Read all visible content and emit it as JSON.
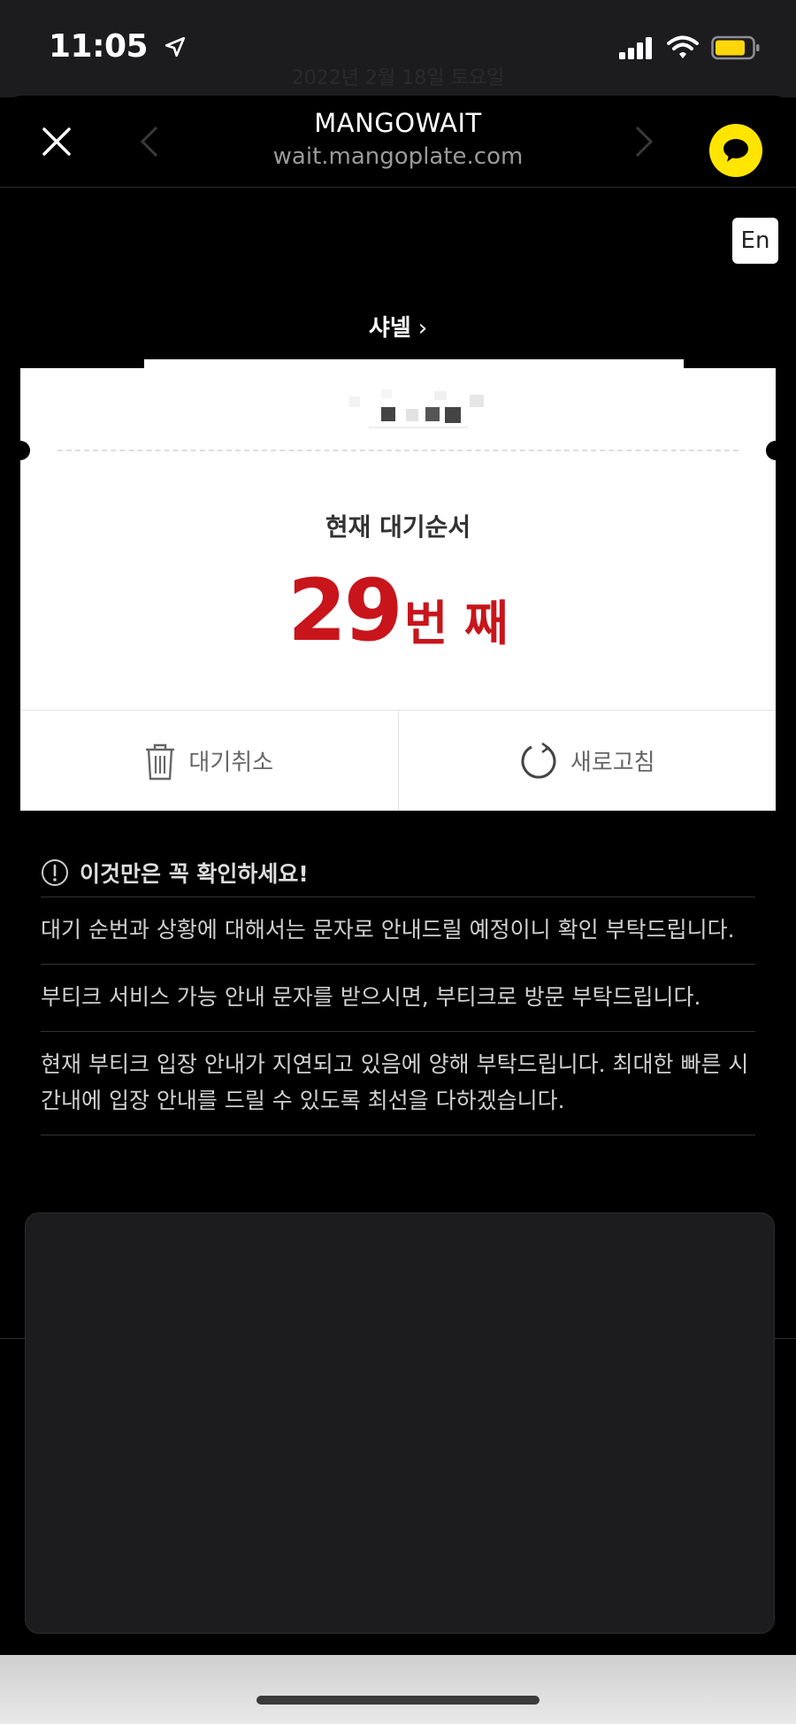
{
  "status_bar": {
    "time": "11:05",
    "faded_date": "2022년 2월 18일 토요일"
  },
  "browser": {
    "title": "MANGOWAIT",
    "url": "wait.mangoplate.com"
  },
  "lang_button": "En",
  "store": {
    "name": "샤넬",
    "chevron": "›"
  },
  "queue": {
    "label": "현재 대기순서",
    "number": "29",
    "unit": "번 째"
  },
  "actions": {
    "cancel": "대기취소",
    "refresh": "새로고침"
  },
  "notice": {
    "title": "이것만은 꼭 확인하세요!",
    "items": [
      "대기 순번과 상황에 대해서는 문자로 안내드릴 예정이니 확인 부탁드립니다.",
      "부티크 서비스 가능 안내 문자를 받으시면, 부티크로 방문 부탁드립니다.",
      "현재 부티크 입장 안내가 지연되고 있음에 양해 부탁드립니다. 최대한 빠른 시간내에 입장 안내를 드릴 수 있도록 최선을 다하겠습니다."
    ]
  },
  "colors": {
    "accent_red": "#c8151b",
    "chat_yellow": "#ffe500",
    "battery_yellow": "#ffd60a"
  }
}
